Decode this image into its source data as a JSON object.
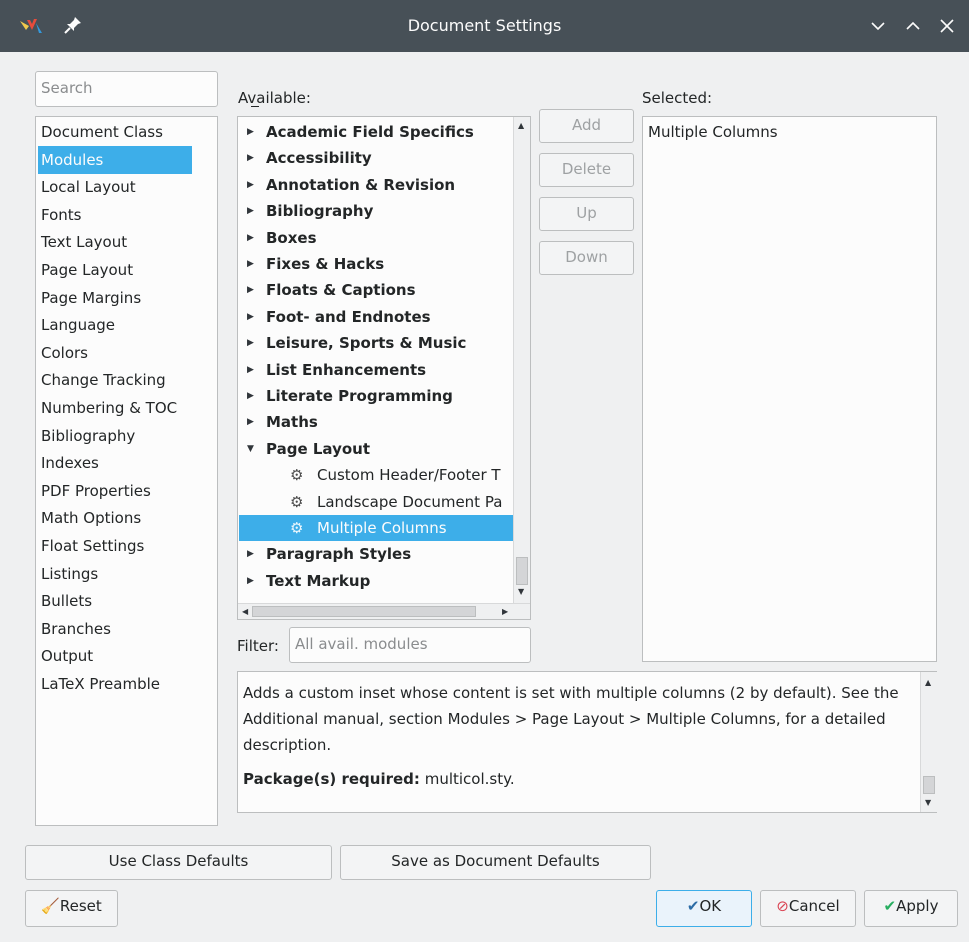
{
  "window": {
    "title": "Document Settings",
    "logo_icon": "lyx-logo-icon",
    "pin_icon": "pin-icon",
    "controls": [
      "minimize-icon",
      "maximize-icon",
      "close-icon"
    ]
  },
  "search": {
    "placeholder": "Search"
  },
  "categories": [
    "Document Class",
    "Modules",
    "Local Layout",
    "Fonts",
    "Text Layout",
    "Page Layout",
    "Page Margins",
    "Language",
    "Colors",
    "Change Tracking",
    "Numbering & TOC",
    "Bibliography",
    "Indexes",
    "PDF Properties",
    "Math Options",
    "Float Settings",
    "Listings",
    "Bullets",
    "Branches",
    "Output",
    "LaTeX Preamble"
  ],
  "selected_category": "Modules",
  "available": {
    "label": "Available:",
    "groups": [
      "Academic Field Specifics",
      "Accessibility",
      "Annotation & Revision",
      "Bibliography",
      "Boxes",
      "Fixes & Hacks",
      "Floats & Captions",
      "Foot- and Endnotes",
      "Leisure, Sports & Music",
      "List Enhancements",
      "Literate Programming",
      "Maths",
      "Page Layout"
    ],
    "expanded_group": "Page Layout",
    "modules": [
      "Custom Header/Footer T",
      "Landscape Document Pa",
      "Multiple Columns"
    ],
    "selected_module": "Multiple Columns",
    "trailing_groups": [
      "Paragraph Styles",
      "Text Markup"
    ]
  },
  "buttons": {
    "add": "Add",
    "delete": "Delete",
    "up": "Up",
    "down": "Down",
    "use_class_defaults": "Use Class Defaults",
    "save_as_document_defaults": "Save as Document Defaults",
    "reset": "Reset",
    "ok": "OK",
    "cancel": "Cancel",
    "apply": "Apply"
  },
  "selected_panel": {
    "label": "Selected:",
    "items": [
      "Multiple Columns"
    ]
  },
  "filter": {
    "label": "Filter:",
    "placeholder": "All avail. modules"
  },
  "description": {
    "text": "Adds a custom inset whose content is set with multiple columns (2 by default). See the Additional manual, section Modules > Page Layout > Multiple Columns, for a detailed description.",
    "package_label": "Package(s) required:",
    "package_value": "multicol.sty."
  },
  "colors": {
    "titlebar": "#475057",
    "selection": "#3daee9",
    "window_bg": "#eff0f1"
  }
}
